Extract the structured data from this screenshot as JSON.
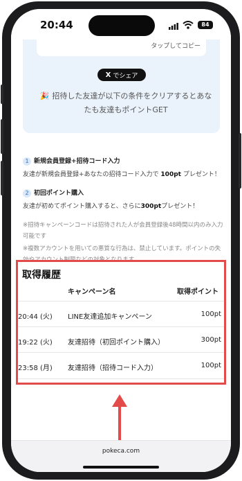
{
  "status_bar": {
    "time": "20:44",
    "battery": "84"
  },
  "share_box": {
    "copy_hint": "タップしてコピー",
    "x_share_icon": "X",
    "x_share_label": "でシェア",
    "condition_icon": "party-popper-icon",
    "condition_text": "招待した友達が以下の条件をクリアするとあなたも友達もポイントGET"
  },
  "steps": [
    {
      "num": "1",
      "title": "新規会員登録+招待コード入力",
      "desc_pre": "友達が新規会員登録+あなたの招待コード入力で",
      "desc_pts": "100pt",
      "desc_post": "プレゼント！"
    },
    {
      "num": "2",
      "title": "初回ポイント購入",
      "desc_pre": "友達が初めてポイント購入すると、さらに",
      "desc_pts": "300pt",
      "desc_post": "プレゼント！"
    }
  ],
  "notes": [
    "※招待キャンペーンコードは招待された人が会員登録後48時間以内のみ入力可能です",
    "※複数アカウントを用いての悪質な行為は、禁止しています。ポイントの失効やアカウント制限などの対象となります。"
  ],
  "history": {
    "title": "取得履歴",
    "headers": {
      "campaign": "キャンペーン名",
      "points": "取得ポイント"
    },
    "rows": [
      {
        "date": "(火) 20:44",
        "campaign": "LINE友達追加キャンペーン",
        "points": "100pt"
      },
      {
        "date": "(火) 19:22",
        "campaign": "友達招待（初回ポイント購入）",
        "points": "300pt"
      },
      {
        "date": "(月) 23:58",
        "campaign": "友達招待（招待コード入力）",
        "points": "100pt"
      }
    ]
  },
  "browser": {
    "url": "pokeca.com"
  },
  "colors": {
    "highlight": "#e34b4b",
    "share_bg": "#eaf2fb",
    "accent_blue": "#2a6fc9"
  }
}
